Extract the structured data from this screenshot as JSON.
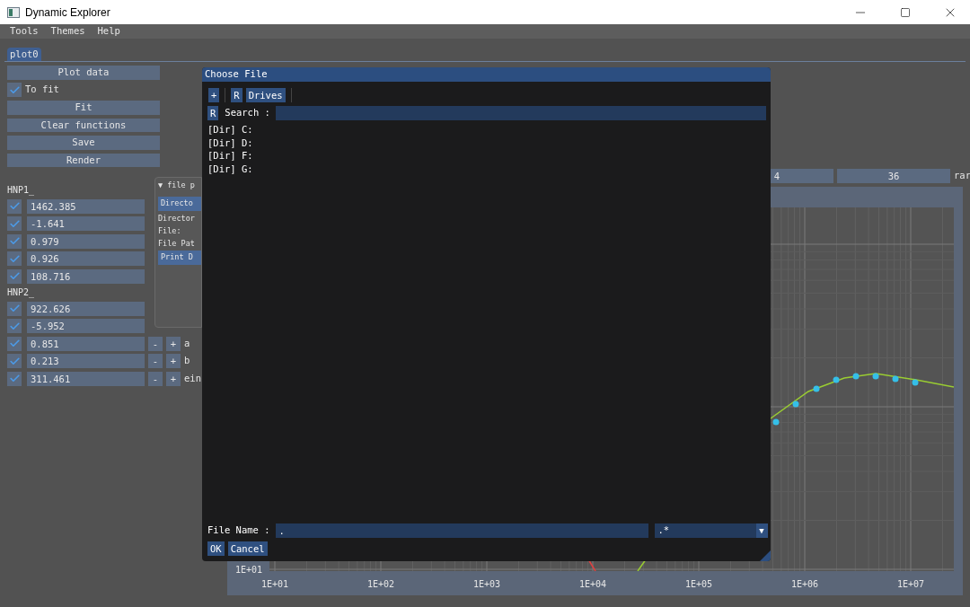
{
  "window": {
    "title": "Dynamic Explorer"
  },
  "menu": [
    "Tools",
    "Themes",
    "Help"
  ],
  "tabs": [
    {
      "label": "plot0",
      "selected": true
    }
  ],
  "actions": [
    {
      "kind": "button",
      "label": "Plot data"
    },
    {
      "kind": "checkbox",
      "label": "To fit",
      "checked": true
    },
    {
      "kind": "button",
      "label": "Fit"
    },
    {
      "kind": "button",
      "label": "Clear functions"
    },
    {
      "kind": "button",
      "label": "Save"
    },
    {
      "kind": "button",
      "label": "Render"
    }
  ],
  "groups": [
    {
      "title": "HNP1_",
      "params": [
        {
          "value": "1462.385",
          "checked": true
        },
        {
          "value": "-1.641",
          "checked": true
        },
        {
          "value": "0.979",
          "checked": true
        },
        {
          "value": "0.926",
          "checked": true
        },
        {
          "value": "108.716",
          "checked": true
        }
      ]
    },
    {
      "title": "HNP2_",
      "params": [
        {
          "value": "922.626",
          "checked": true
        },
        {
          "value": "-5.952",
          "checked": true
        },
        {
          "value": "0.851",
          "checked": true,
          "minus": "-",
          "plus": "+",
          "label": "a"
        },
        {
          "value": "0.213",
          "checked": true,
          "minus": "-",
          "plus": "+",
          "label": "b"
        },
        {
          "value": "311.461",
          "checked": true,
          "minus": "-",
          "plus": "+",
          "label": "ein"
        }
      ]
    }
  ],
  "range_fields": [
    "4",
    "36"
  ],
  "range_label": "rar",
  "plot": {
    "x_tick_labels": [
      "1E+01",
      "1E+02",
      "1E+03",
      "1E+04",
      "1E+05",
      "1E+06",
      "1E+07"
    ],
    "y_tick_labels": [
      "1E+01"
    ]
  },
  "file_picker": {
    "title": "▼ file p",
    "directory_button": "Directo",
    "lines": [
      "Director",
      "File:",
      "File Pat"
    ],
    "print_button": "Print D"
  },
  "dialog": {
    "title": "Choose File",
    "toolbar": [
      "+",
      "R",
      "Drives"
    ],
    "search": {
      "reset": "R",
      "label": "Search :"
    },
    "entries": [
      {
        "label": "[Dir] C:",
        "selected": false
      },
      {
        "label": "[Dir] D:",
        "selected": false
      },
      {
        "label": "[Dir] F:",
        "selected": false
      },
      {
        "label": "[Dir] G:",
        "selected": false
      }
    ],
    "file_name": {
      "label": "File Name :",
      "value": "."
    },
    "filter": {
      "value": ".*",
      "arrow": "▼"
    },
    "buttons": [
      "OK",
      "Cancel"
    ]
  }
}
